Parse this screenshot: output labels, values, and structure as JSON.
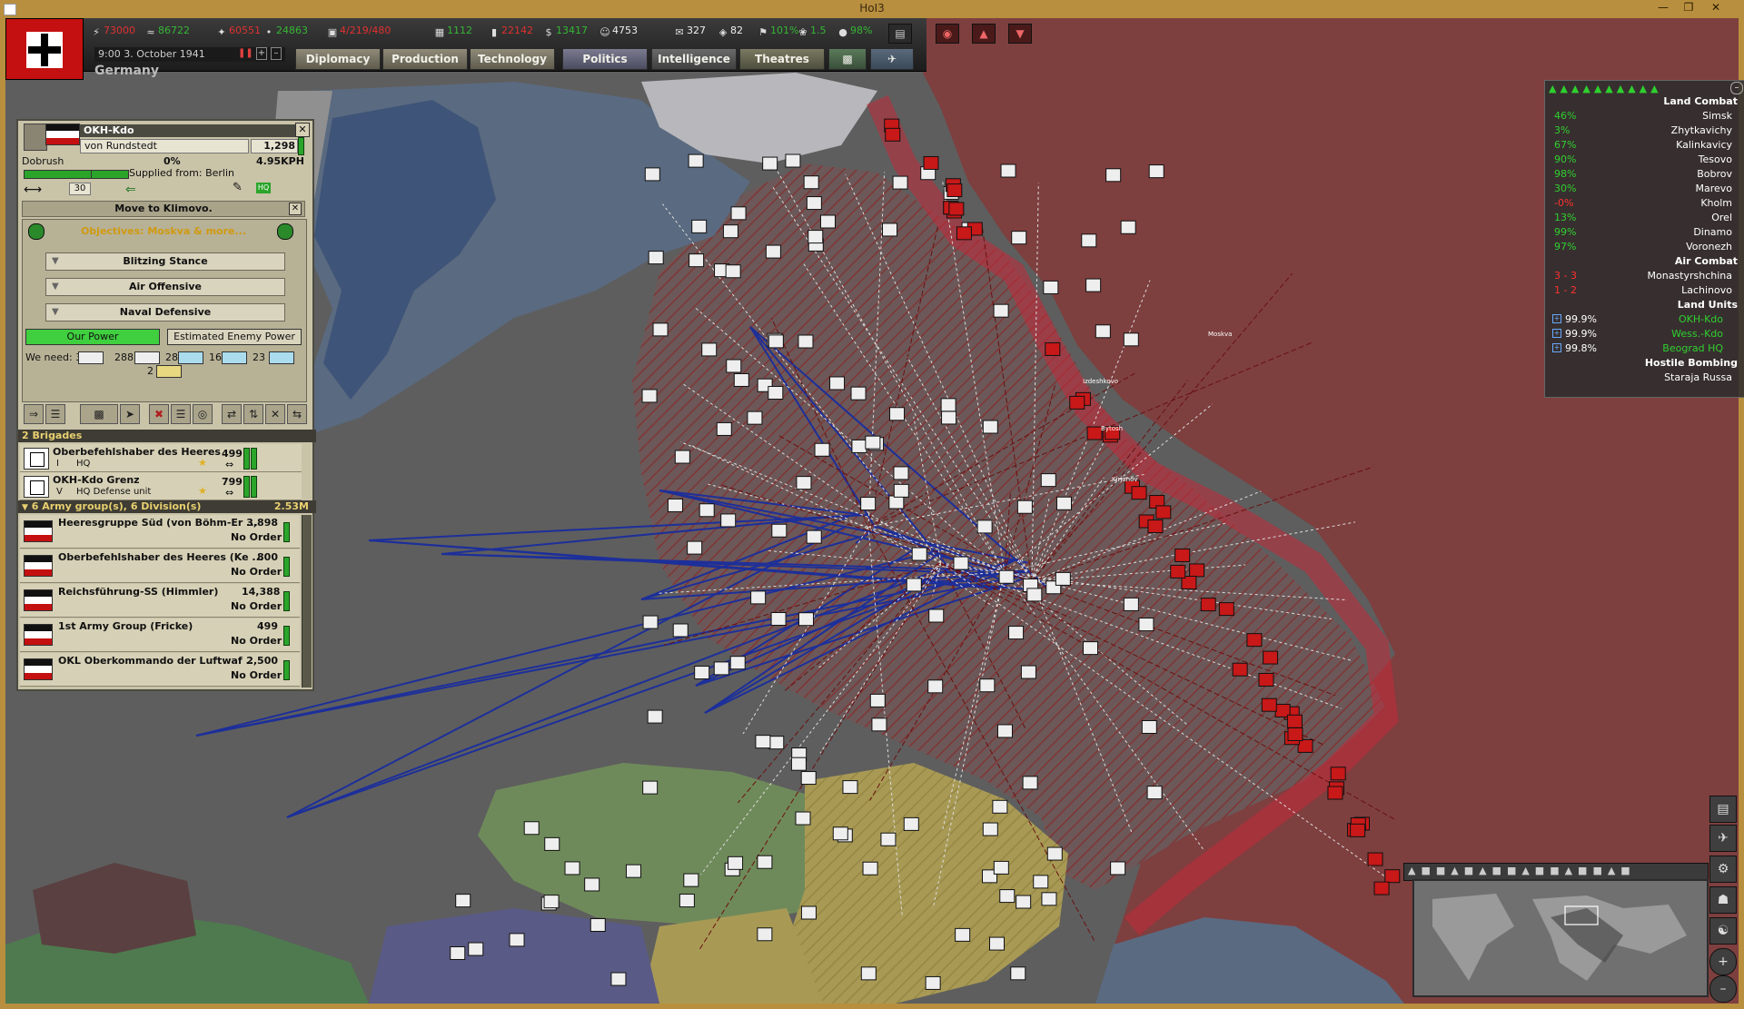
{
  "window": {
    "title": "HoI3",
    "controls": [
      "minimize",
      "restore",
      "close"
    ]
  },
  "resources": [
    {
      "name": "energy",
      "icon": "lightning-icon",
      "value": "73000",
      "color": "#e03030"
    },
    {
      "name": "metal",
      "icon": "metal-icon",
      "value": "86722",
      "color": "#35b635"
    },
    {
      "name": "rare-materials",
      "icon": "rare-materials-icon",
      "value": "60551",
      "color": "#e03030"
    },
    {
      "name": "crude-oil",
      "icon": "oil-drop-icon",
      "value": "24863",
      "color": "#35b635"
    },
    {
      "name": "ic",
      "icon": "factory-icon",
      "value": "4/219/480",
      "color": "#e03030"
    },
    {
      "name": "supplies",
      "icon": "supplies-icon",
      "value": "1112",
      "color": "#35b635"
    },
    {
      "name": "fuel",
      "icon": "fuel-icon",
      "value": "22142",
      "color": "#e03030"
    },
    {
      "name": "money",
      "icon": "dollar-icon",
      "value": "13417",
      "color": "#35b635"
    },
    {
      "name": "manpower",
      "icon": "manpower-icon",
      "value": "4753",
      "color": "#f0f0f0"
    },
    {
      "name": "diplomatic-influence",
      "icon": "envelope-icon",
      "value": "327",
      "color": "#f0f0f0"
    },
    {
      "name": "officers",
      "icon": "officers-icon",
      "value": "82",
      "color": "#f0f0f0"
    },
    {
      "name": "national-unity",
      "icon": "flag-icon",
      "value": "101%",
      "color": "#35b635"
    },
    {
      "name": "dissent",
      "icon": "dissent-icon",
      "value": "1.5",
      "color": "#35b635"
    },
    {
      "name": "neutrality",
      "icon": "globe-icon",
      "value": "98%",
      "color": "#35b635"
    }
  ],
  "date": "9:00 3. October 1941",
  "country": "Germany",
  "tabs": [
    "Diplomacy",
    "Production",
    "Technology",
    "Politics",
    "Intelligence",
    "Theatres"
  ],
  "unit": {
    "name": "OKH-Kdo",
    "commander": "von Rundstedt",
    "strength": "1,298",
    "location": "Dobrush",
    "progress": "0%",
    "speed": "4.95KPH",
    "supply": "Supplied from: Berlin",
    "stat": "30",
    "order": "Move to Klimovo.",
    "objectives": "Objectives: Moskva & more...",
    "stances": [
      "Blitzing Stance",
      "Air Offensive",
      "Naval Defensive"
    ],
    "our_power": "Our Power",
    "enemy_power": "Estimated Enemy Power",
    "we_need": "We need: 3",
    "needs": [
      "288",
      "28",
      "16",
      "23",
      "2"
    ]
  },
  "brigades": {
    "header": "2 Brigades",
    "items": [
      {
        "name": "Oberbefehlshaber des Heeres",
        "rank": "I",
        "type": "HQ",
        "value": "499"
      },
      {
        "name": "OKH-Kdo Grenz",
        "rank": "V",
        "type": "HQ Defense unit",
        "value": "799"
      }
    ]
  },
  "subunits": {
    "header": "6 Army group(s), 6 Division(s)",
    "total": "2.53M",
    "items": [
      {
        "name": "Heeresgruppe Süd (von Böhm-Er ...",
        "value": "3,898",
        "order": "No Order"
      },
      {
        "name": "Oberbefehlshaber des Heeres (Ke ...",
        "value": "800",
        "order": "No Order"
      },
      {
        "name": "Reichsführung-SS (Himmler)",
        "value": "14,388",
        "order": "No Order"
      },
      {
        "name": "1st Army Group (Fricke)",
        "value": "499",
        "order": "No Order"
      },
      {
        "name": "OKL Oberkommando der Luftwaf ...",
        "value": "2,500",
        "order": "No Order"
      }
    ]
  },
  "combat": {
    "land_combat_title": "Land Combat",
    "land_combat": [
      {
        "pct": "46%",
        "place": "Simsk"
      },
      {
        "pct": "3%",
        "place": "Zhytkavichy"
      },
      {
        "pct": "67%",
        "place": "Kalinkavicy"
      },
      {
        "pct": "90%",
        "place": "Tesovo"
      },
      {
        "pct": "98%",
        "place": "Bobrov"
      },
      {
        "pct": "30%",
        "place": "Marevo"
      },
      {
        "pct": "-0%",
        "place": "Kholm"
      },
      {
        "pct": "13%",
        "place": "Orel"
      },
      {
        "pct": "99%",
        "place": "Dinamo"
      },
      {
        "pct": "97%",
        "place": "Voronezh"
      }
    ],
    "air_combat_title": "Air Combat",
    "air_combat": [
      {
        "score": "3 - 3",
        "place": "Monastyrshchina"
      },
      {
        "score": "1 - 2",
        "place": "Lachinovo"
      }
    ],
    "land_units_title": "Land Units",
    "land_units": [
      {
        "pct": "99.9%",
        "name": "OKH-Kdo"
      },
      {
        "pct": "99.9%",
        "name": "Wess.-Kdo"
      },
      {
        "pct": "99.8%",
        "name": "Beograd HQ"
      }
    ],
    "bombing_title": "Hostile Bombing",
    "bombing": [
      "Staraja Russa"
    ]
  },
  "map_labels": [
    "Moskva",
    "Izdeshkovo",
    "Bytosh",
    "Kirjanov"
  ],
  "colors": {
    "germany": "#5a5a5a",
    "ussr": "#7a3a3a",
    "accent_green": "#2fcf2f",
    "accent_red": "#ff3030"
  }
}
